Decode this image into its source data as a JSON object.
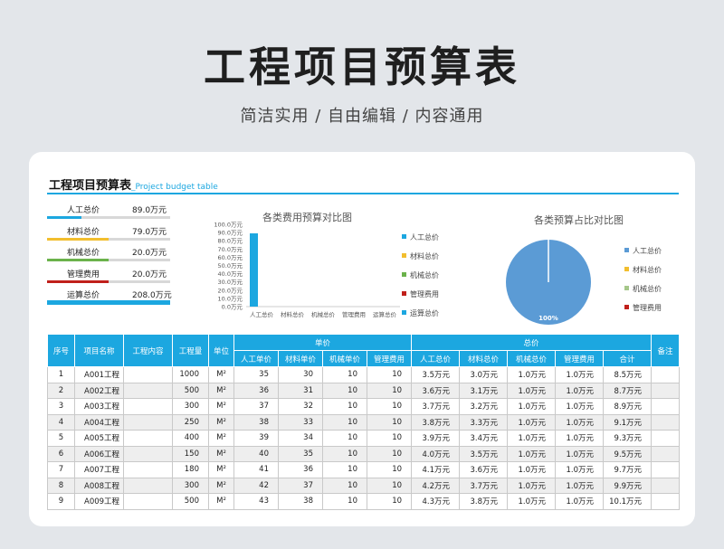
{
  "header": {
    "title": "工程项目预算表",
    "subtitle": "简洁实用 / 自由编辑 / 内容通用"
  },
  "sheet": {
    "title": "工程项目预算表",
    "title_en": "_Project budget table"
  },
  "summary": [
    {
      "label": "人工总价",
      "value": "89.0万元",
      "color": "#1ca7e0",
      "fraction": 0.28
    },
    {
      "label": "材料总价",
      "value": "79.0万元",
      "color": "#f2be2e",
      "fraction": 0.5
    },
    {
      "label": "机械总价",
      "value": "20.0万元",
      "color": "#6bb24b",
      "fraction": 0.5
    },
    {
      "label": "管理费用",
      "value": "20.0万元",
      "color": "#c0201b",
      "fraction": 0.5
    },
    {
      "label": "运算总价",
      "value": "208.0万元",
      "color": "#1ca7e0",
      "fraction": 1.0
    }
  ],
  "chart_data": [
    {
      "type": "bar",
      "title": "各类费用预算对比图",
      "categories": [
        "人工总价",
        "材料总价",
        "机械总价",
        "管理费用",
        "运算总价"
      ],
      "values": [
        89,
        0,
        0,
        0,
        0
      ],
      "ylim": [
        0,
        100
      ],
      "yticks": [
        "0.0万元",
        "10.0万元",
        "20.0万元",
        "30.0万元",
        "40.0万元",
        "50.0万元",
        "60.0万元",
        "70.0万元",
        "80.0万元",
        "90.0万元",
        "100.0万元"
      ],
      "bar_color": "#1ca7e0",
      "legend": [
        {
          "name": "人工总价",
          "color": "#1ca7e0"
        },
        {
          "name": "材料总价",
          "color": "#f2be2e"
        },
        {
          "name": "机械总价",
          "color": "#6bb24b"
        },
        {
          "name": "管理费用",
          "color": "#c0201b"
        },
        {
          "name": "运算总价",
          "color": "#1ca7e0"
        }
      ]
    },
    {
      "type": "pie",
      "title": "各类预算占比对比图",
      "categories": [
        "人工总价",
        "材料总价",
        "机械总价",
        "管理费用"
      ],
      "values": [
        100,
        0,
        0,
        0
      ],
      "slice_label": "100%",
      "legend": [
        {
          "name": "人工总价",
          "color": "#5b9bd5"
        },
        {
          "name": "材料总价",
          "color": "#f2be2e"
        },
        {
          "name": "机械总价",
          "color": "#a5c78a"
        },
        {
          "name": "管理费用",
          "color": "#c0201b"
        }
      ]
    }
  ],
  "table": {
    "headers": {
      "seq": "序号",
      "name": "项目名称",
      "content": "工程内容",
      "qty": "工程量",
      "unit": "单位",
      "unit_price": "单价",
      "total": "总价",
      "remark": "备注",
      "labor_u": "人工单价",
      "mat_u": "材料单价",
      "mach_u": "机械单价",
      "mgmt_u": "管理费用",
      "labor_t": "人工总价",
      "mat_t": "材料总价",
      "mach_t": "机械总价",
      "mgmt_t": "管理费用",
      "sum_t": "合计"
    },
    "rows": [
      [
        "1",
        "A001工程",
        "",
        "1000",
        "M²",
        "35",
        "30",
        "10",
        "10",
        "3.5万元",
        "3.0万元",
        "1.0万元",
        "1.0万元",
        "8.5万元",
        ""
      ],
      [
        "2",
        "A002工程",
        "",
        "500",
        "M²",
        "36",
        "31",
        "10",
        "10",
        "3.6万元",
        "3.1万元",
        "1.0万元",
        "1.0万元",
        "8.7万元",
        ""
      ],
      [
        "3",
        "A003工程",
        "",
        "300",
        "M²",
        "37",
        "32",
        "10",
        "10",
        "3.7万元",
        "3.2万元",
        "1.0万元",
        "1.0万元",
        "8.9万元",
        ""
      ],
      [
        "4",
        "A004工程",
        "",
        "250",
        "M²",
        "38",
        "33",
        "10",
        "10",
        "3.8万元",
        "3.3万元",
        "1.0万元",
        "1.0万元",
        "9.1万元",
        ""
      ],
      [
        "5",
        "A005工程",
        "",
        "400",
        "M²",
        "39",
        "34",
        "10",
        "10",
        "3.9万元",
        "3.4万元",
        "1.0万元",
        "1.0万元",
        "9.3万元",
        ""
      ],
      [
        "6",
        "A006工程",
        "",
        "150",
        "M²",
        "40",
        "35",
        "10",
        "10",
        "4.0万元",
        "3.5万元",
        "1.0万元",
        "1.0万元",
        "9.5万元",
        ""
      ],
      [
        "7",
        "A007工程",
        "",
        "180",
        "M²",
        "41",
        "36",
        "10",
        "10",
        "4.1万元",
        "3.6万元",
        "1.0万元",
        "1.0万元",
        "9.7万元",
        ""
      ],
      [
        "8",
        "A008工程",
        "",
        "300",
        "M²",
        "42",
        "37",
        "10",
        "10",
        "4.2万元",
        "3.7万元",
        "1.0万元",
        "1.0万元",
        "9.9万元",
        ""
      ],
      [
        "9",
        "A009工程",
        "",
        "500",
        "M²",
        "43",
        "38",
        "10",
        "10",
        "4.3万元",
        "3.8万元",
        "1.0万元",
        "1.0万元",
        "10.1万元",
        ""
      ]
    ]
  }
}
